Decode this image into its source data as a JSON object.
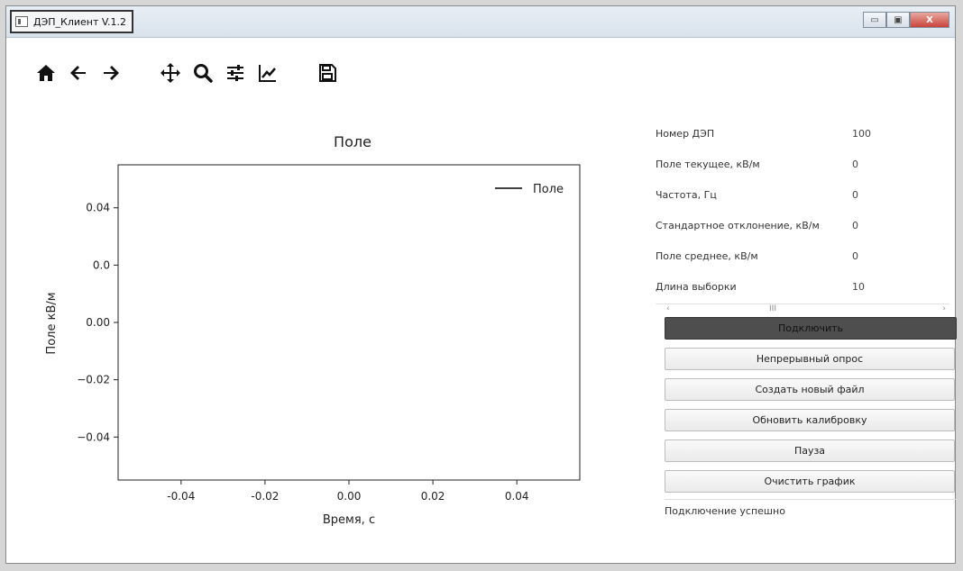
{
  "window": {
    "title": "ДЭП_Клиент V.1.2",
    "controls": {
      "minimize": "▭",
      "maximize": "▣",
      "close": "X"
    }
  },
  "toolbar": {
    "icons": [
      "home-icon",
      "back-arrow-icon",
      "forward-arrow-icon",
      "pan-move-icon",
      "zoom-magnifier-icon",
      "configure-subplots-icon",
      "edit-axis-icon",
      "save-disk-icon"
    ]
  },
  "chart_data": {
    "type": "line",
    "title": "Поле",
    "xlabel": "Время, с",
    "ylabel": "Поле кВ/м",
    "xlim": [
      -0.055,
      0.055
    ],
    "ylim": [
      -0.055,
      0.055
    ],
    "x_ticks": [
      "-0.04",
      "-0.02",
      "0.00",
      "0.02",
      "0.04"
    ],
    "x_tick_values": [
      -0.04,
      -0.02,
      0.0,
      0.02,
      0.04
    ],
    "y_ticks": [
      "0.04",
      "0.0",
      "0.00",
      "−0.02",
      "−0.04"
    ],
    "y_tick_values": [
      0.04,
      0.02,
      0.0,
      -0.02,
      -0.04
    ],
    "series": [
      {
        "name": "Поле",
        "x": [],
        "y": [],
        "color": "#000000"
      }
    ],
    "legend": "top-right",
    "grid": false
  },
  "params": [
    {
      "label": "Номер ДЭП",
      "value": "100"
    },
    {
      "label": "Поле текущее, кВ/м",
      "value": "0"
    },
    {
      "label": "Частота, Гц",
      "value": "0"
    },
    {
      "label": "Стандартное отклонение, кВ/м",
      "value": "0"
    },
    {
      "label": "Поле среднее, кВ/м",
      "value": "0"
    },
    {
      "label": "Длина выборки",
      "value": "10"
    }
  ],
  "scrollbar": {
    "left": "‹",
    "thumb": "III",
    "right": "›"
  },
  "buttons": {
    "connect": "Подключить",
    "continuous": "Непрерывный опрос",
    "new_file": "Создать новый файл",
    "calibration": "Обновить калибровку",
    "pause": "Пауза",
    "clear": "Очистить график"
  },
  "status": "Подключение успешно"
}
